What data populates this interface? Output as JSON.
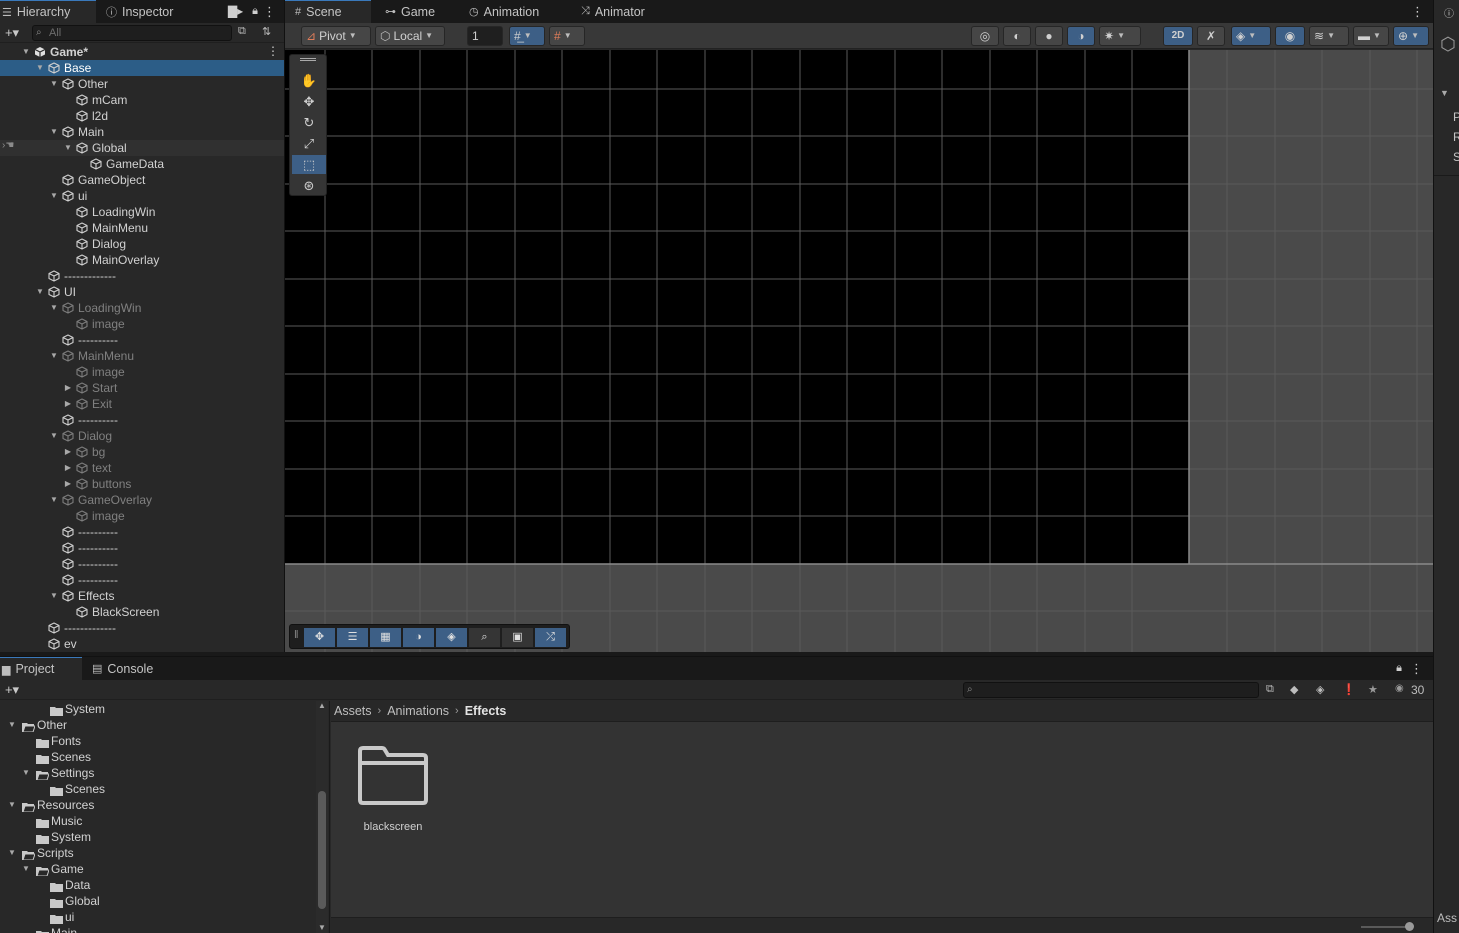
{
  "hierarchy": {
    "tabs": [
      {
        "label": "Hierarchy",
        "icon": "list-icon",
        "active": true
      },
      {
        "label": "Inspector",
        "icon": "info-icon",
        "active": false
      }
    ],
    "search_placeholder": "All",
    "rows": [
      {
        "label": "Game*",
        "depth": 0,
        "arrow": "down",
        "kind": "scene",
        "bold": true
      },
      {
        "label": "Base",
        "depth": 1,
        "arrow": "down",
        "selected": true
      },
      {
        "label": "Other",
        "depth": 2,
        "arrow": "down"
      },
      {
        "label": "mCam",
        "depth": 3
      },
      {
        "label": "l2d",
        "depth": 3
      },
      {
        "label": "Main",
        "depth": 2,
        "arrow": "down"
      },
      {
        "label": "Global",
        "depth": 3,
        "arrow": "down",
        "hover": true
      },
      {
        "label": "GameData",
        "depth": 4
      },
      {
        "label": "GameObject",
        "depth": 2
      },
      {
        "label": "ui",
        "depth": 2,
        "arrow": "down"
      },
      {
        "label": "LoadingWin",
        "depth": 3
      },
      {
        "label": "MainMenu",
        "depth": 3
      },
      {
        "label": "Dialog",
        "depth": 3
      },
      {
        "label": "MainOverlay",
        "depth": 3
      },
      {
        "label": "-------------",
        "depth": 1
      },
      {
        "label": "UI",
        "depth": 1,
        "arrow": "down"
      },
      {
        "label": "LoadingWin",
        "depth": 2,
        "arrow": "down",
        "dim": true
      },
      {
        "label": "image",
        "depth": 3,
        "dim": true
      },
      {
        "label": "----------",
        "depth": 2
      },
      {
        "label": "MainMenu",
        "depth": 2,
        "arrow": "down",
        "dim": true
      },
      {
        "label": "image",
        "depth": 3,
        "dim": true
      },
      {
        "label": "Start",
        "depth": 3,
        "arrow": "right",
        "dim": true
      },
      {
        "label": "Exit",
        "depth": 3,
        "arrow": "right",
        "dim": true
      },
      {
        "label": "----------",
        "depth": 2
      },
      {
        "label": "Dialog",
        "depth": 2,
        "arrow": "down",
        "dim": true
      },
      {
        "label": "bg",
        "depth": 3,
        "arrow": "right",
        "dim": true
      },
      {
        "label": "text",
        "depth": 3,
        "arrow": "right",
        "dim": true
      },
      {
        "label": "buttons",
        "depth": 3,
        "arrow": "right",
        "dim": true
      },
      {
        "label": "GameOverlay",
        "depth": 2,
        "arrow": "down",
        "dim": true
      },
      {
        "label": "image",
        "depth": 3,
        "dim": true
      },
      {
        "label": "----------",
        "depth": 2
      },
      {
        "label": "----------",
        "depth": 2
      },
      {
        "label": "----------",
        "depth": 2
      },
      {
        "label": "----------",
        "depth": 2
      },
      {
        "label": "Effects",
        "depth": 2,
        "arrow": "down"
      },
      {
        "label": "BlackScreen",
        "depth": 3
      },
      {
        "label": "-------------",
        "depth": 1
      },
      {
        "label": "ev",
        "depth": 1
      }
    ]
  },
  "scene": {
    "tabs": [
      {
        "label": "Scene",
        "icon": "grid-icon",
        "active": true
      },
      {
        "label": "Game",
        "icon": "gamepad-icon",
        "active": false
      },
      {
        "label": "Animation",
        "icon": "clock-icon",
        "active": false
      },
      {
        "label": "Animator",
        "icon": "graph-icon",
        "active": false
      }
    ],
    "toolbar": {
      "pivot_label": "Pivot",
      "local_label": "Local",
      "grid_snap_value": "1",
      "mode_2d_label": "2D"
    }
  },
  "project": {
    "tabs": [
      {
        "label": "Project",
        "icon": "folder-icon",
        "active": true
      },
      {
        "label": "Console",
        "icon": "console-icon",
        "active": false
      }
    ],
    "hidden_count": "30",
    "tree": [
      {
        "label": "System",
        "depth": 2
      },
      {
        "label": "Other",
        "depth": 0,
        "arrow": "down",
        "open": true
      },
      {
        "label": "Fonts",
        "depth": 1
      },
      {
        "label": "Scenes",
        "depth": 1
      },
      {
        "label": "Settings",
        "depth": 1,
        "arrow": "down",
        "open": true
      },
      {
        "label": "Scenes",
        "depth": 2
      },
      {
        "label": "Resources",
        "depth": 0,
        "arrow": "down",
        "open": true
      },
      {
        "label": "Music",
        "depth": 1
      },
      {
        "label": "System",
        "depth": 1
      },
      {
        "label": "Scripts",
        "depth": 0,
        "arrow": "down",
        "open": true
      },
      {
        "label": "Game",
        "depth": 1,
        "arrow": "down",
        "open": true
      },
      {
        "label": "Data",
        "depth": 2
      },
      {
        "label": "Global",
        "depth": 2
      },
      {
        "label": "ui",
        "depth": 2
      },
      {
        "label": "Main",
        "depth": 1
      }
    ],
    "breadcrumb": [
      "Assets",
      "Animations",
      "Effects"
    ],
    "assets": [
      {
        "name": "blackscreen",
        "icon": "folder-icon"
      }
    ]
  },
  "right_strip": {
    "letters": [
      "P",
      "R",
      "S"
    ],
    "footer": "Ass"
  }
}
